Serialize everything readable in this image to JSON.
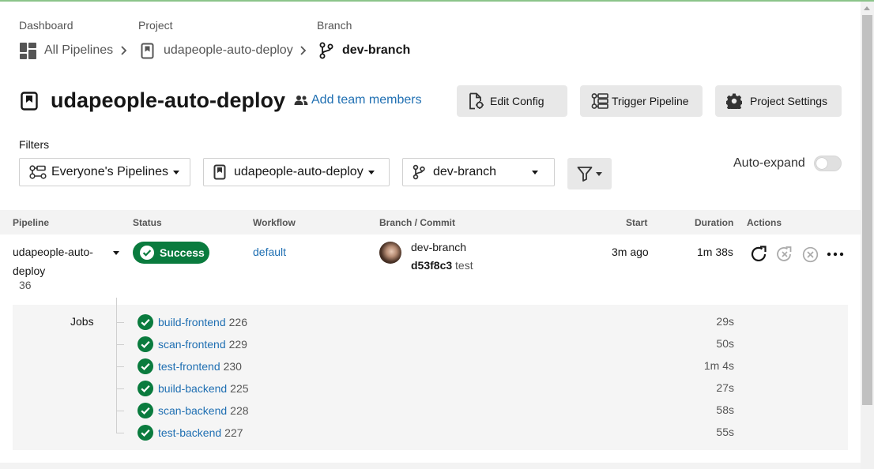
{
  "breadcrumb_headers": {
    "dashboard": "Dashboard",
    "project": "Project",
    "branch": "Branch"
  },
  "breadcrumbs": {
    "all_pipelines": "All Pipelines",
    "project": "udapeople-auto-deploy",
    "branch": "dev-branch"
  },
  "project_title": "udapeople-auto-deploy",
  "add_team_members": "Add team members",
  "buttons": {
    "edit_config": "Edit Config",
    "trigger_pipeline": "Trigger Pipeline",
    "project_settings": "Project Settings"
  },
  "filters": {
    "label": "Filters",
    "everyone": "Everyone's Pipelines",
    "project": "udapeople-auto-deploy",
    "branch": "dev-branch",
    "auto_expand": "Auto-expand",
    "auto_expand_on": false
  },
  "table_headers": {
    "pipeline": "Pipeline",
    "status": "Status",
    "workflow": "Workflow",
    "branch_commit": "Branch / Commit",
    "start": "Start",
    "duration": "Duration",
    "actions": "Actions"
  },
  "pipeline_row": {
    "name": "udapeople-auto-deploy",
    "number": "36",
    "status": "Success",
    "workflow": "default",
    "branch": "dev-branch",
    "commit_hash": "d53f8c3",
    "commit_msg": "test",
    "start": "3m ago",
    "duration": "1m 38s"
  },
  "jobs_label": "Jobs",
  "jobs": [
    {
      "name": "build-frontend",
      "number": "226",
      "duration": "29s"
    },
    {
      "name": "scan-frontend",
      "number": "229",
      "duration": "50s"
    },
    {
      "name": "test-frontend",
      "number": "230",
      "duration": "1m 4s"
    },
    {
      "name": "build-backend",
      "number": "225",
      "duration": "27s"
    },
    {
      "name": "scan-backend",
      "number": "228",
      "duration": "58s"
    },
    {
      "name": "test-backend",
      "number": "227",
      "duration": "55s"
    }
  ],
  "colors": {
    "success": "#0a7b3e",
    "link": "#1f6fb2",
    "button_bg": "#e8e8e8"
  },
  "icons": [
    "dashboard-icon",
    "project-icon",
    "branch-icon",
    "team-icon",
    "edit-config-icon",
    "trigger-icon",
    "gear-icon",
    "filter-icon",
    "check-icon",
    "rerun-icon",
    "rerun-failed-icon",
    "cancel-icon",
    "more-icon"
  ]
}
